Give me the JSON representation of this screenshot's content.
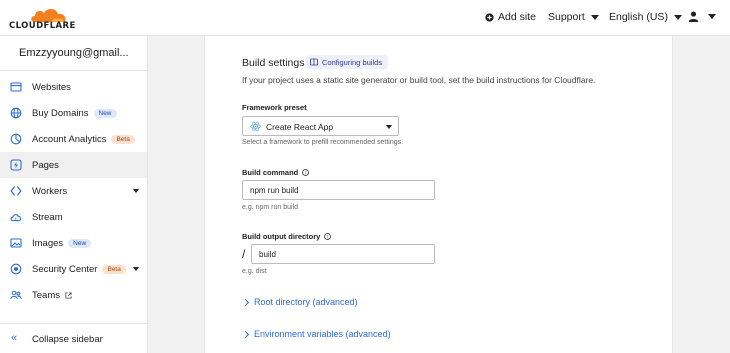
{
  "brand": {
    "name": "CLOUDFLARE",
    "accent": "#f38020"
  },
  "topbar": {
    "add_site": "Add site",
    "support": "Support",
    "language": "English (US)"
  },
  "sidebar": {
    "account": "Emzzyyoung@gmail...",
    "items": [
      {
        "label": "Websites",
        "icon": "browser-window-icon"
      },
      {
        "label": "Buy Domains",
        "badge": "New",
        "icon": "globe-icon"
      },
      {
        "label": "Account Analytics",
        "badge": "Beta",
        "icon": "analytics-icon"
      },
      {
        "label": "Pages",
        "icon": "lightning-icon",
        "active": true
      },
      {
        "label": "Workers",
        "icon": "workers-icon",
        "expandable": true
      },
      {
        "label": "Stream",
        "icon": "cloud-stream-icon"
      },
      {
        "label": "Images",
        "badge": "New",
        "icon": "image-icon"
      },
      {
        "label": "Security Center",
        "badge": "Beta",
        "icon": "security-icon",
        "expandable": true
      },
      {
        "label": "Teams",
        "icon": "teams-icon",
        "external": true
      }
    ],
    "collapse_label": "Collapse sidebar"
  },
  "build": {
    "title": "Build settings",
    "doc_link": "Configuring builds",
    "description": "If your project uses a static site generator or build tool, set the build instructions for Cloudflare.",
    "framework": {
      "label": "Framework preset",
      "value": "Create React App",
      "hint": "Select a framework to prefill recommended settings."
    },
    "command": {
      "label": "Build command",
      "value": "npm run build",
      "hint": "e.g. npm run build"
    },
    "output": {
      "label": "Build output directory",
      "prefix": "/",
      "value": "build",
      "hint": "e.g. dist"
    },
    "root_dir": "Root directory (advanced)",
    "env_vars": "Environment variables (advanced)"
  },
  "colors": {
    "link": "#2c6ed5",
    "badge_new_bg": "#dce8fb",
    "badge_beta_bg": "#fde1cf"
  }
}
